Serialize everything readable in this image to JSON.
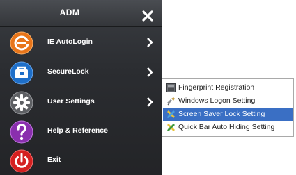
{
  "header": {
    "title": "ADM"
  },
  "menu": {
    "items": [
      {
        "label": "IE AutoLogin",
        "icon": "ie-autologin-icon",
        "color": "#e8751a",
        "has_submenu": true
      },
      {
        "label": "SecureLock",
        "icon": "securelock-icon",
        "color": "#1e6fc9",
        "has_submenu": true
      },
      {
        "label": "User Settings",
        "icon": "gear-icon",
        "color": "#7a7a7a",
        "has_submenu": true
      },
      {
        "label": "Help & Reference",
        "icon": "question-icon",
        "color": "#8a2fae",
        "has_submenu": false
      },
      {
        "label": "Exit",
        "icon": "power-icon",
        "color": "#d42020",
        "has_submenu": false
      }
    ]
  },
  "submenu": {
    "items": [
      {
        "label": "Fingerprint Registration",
        "icon": "fingerprint-icon",
        "selected": false
      },
      {
        "label": "Windows Logon Setting",
        "icon": "windows-logon-icon",
        "selected": false
      },
      {
        "label": "Screen Saver Lock Setting",
        "icon": "tools-icon",
        "selected": true
      },
      {
        "label": "Quick Bar Auto Hiding Setting",
        "icon": "tools-icon",
        "selected": false
      }
    ]
  },
  "colors": {
    "menu_bg": "#2b2d31",
    "selection": "#3a6fc4"
  }
}
